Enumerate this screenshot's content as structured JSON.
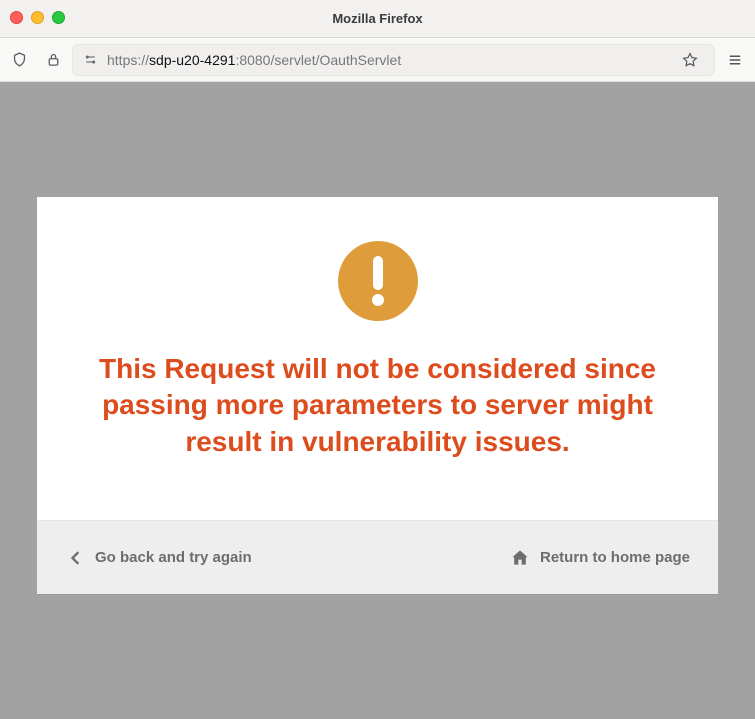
{
  "window": {
    "title": "Mozilla Firefox"
  },
  "addressbar": {
    "protocol": "https://",
    "host": "sdp-u20-4291",
    "port": ":8080",
    "path": "/servlet/OauthServlet"
  },
  "error": {
    "message": "This Request will not be considered since passing more parameters to server might result in vulnerability issues."
  },
  "footer": {
    "back_label": "Go back and try again",
    "home_label": "Return to home page"
  }
}
